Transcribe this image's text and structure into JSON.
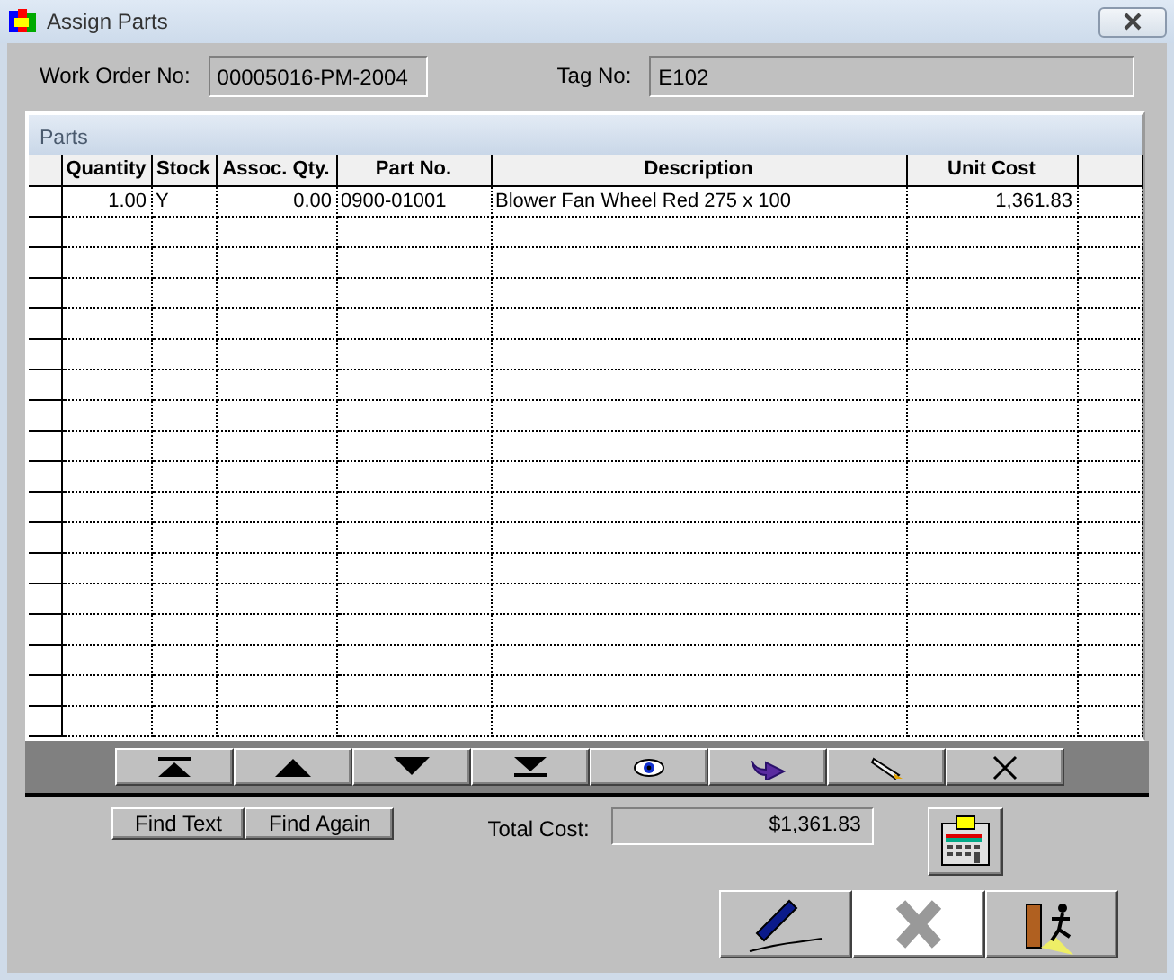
{
  "window": {
    "title": "Assign Parts"
  },
  "fields": [
    {
      "label": "Work Order No:",
      "value": "00005016-PM-2004"
    },
    {
      "label": "Tag No:",
      "value": "E102"
    }
  ],
  "parts": {
    "title": "Parts",
    "columns": [
      "Quantity",
      "Stock",
      "Assoc. Qty.",
      "Part No.",
      "Description",
      "Unit Cost"
    ],
    "rows": [
      [
        "1.00",
        "Y",
        "0.00",
        "0900-01001",
        "Blower Fan Wheel Red 275 x 100",
        "1,361.83"
      ]
    ]
  },
  "navigator": [
    {
      "kind": "first"
    },
    {
      "kind": "prev"
    },
    {
      "kind": "next"
    },
    {
      "kind": "last"
    },
    {
      "kind": "view"
    },
    {
      "kind": "goto"
    },
    {
      "kind": "edit"
    },
    {
      "kind": "delete"
    }
  ],
  "find_buttons": [
    "Find Text",
    "Find Again"
  ],
  "total": {
    "label": "Total Cost:",
    "value": "$1,361.83"
  },
  "actions": [
    {
      "kind": "sign",
      "disabled": false
    },
    {
      "kind": "cancel",
      "disabled": true
    },
    {
      "kind": "exit",
      "disabled": false
    }
  ]
}
